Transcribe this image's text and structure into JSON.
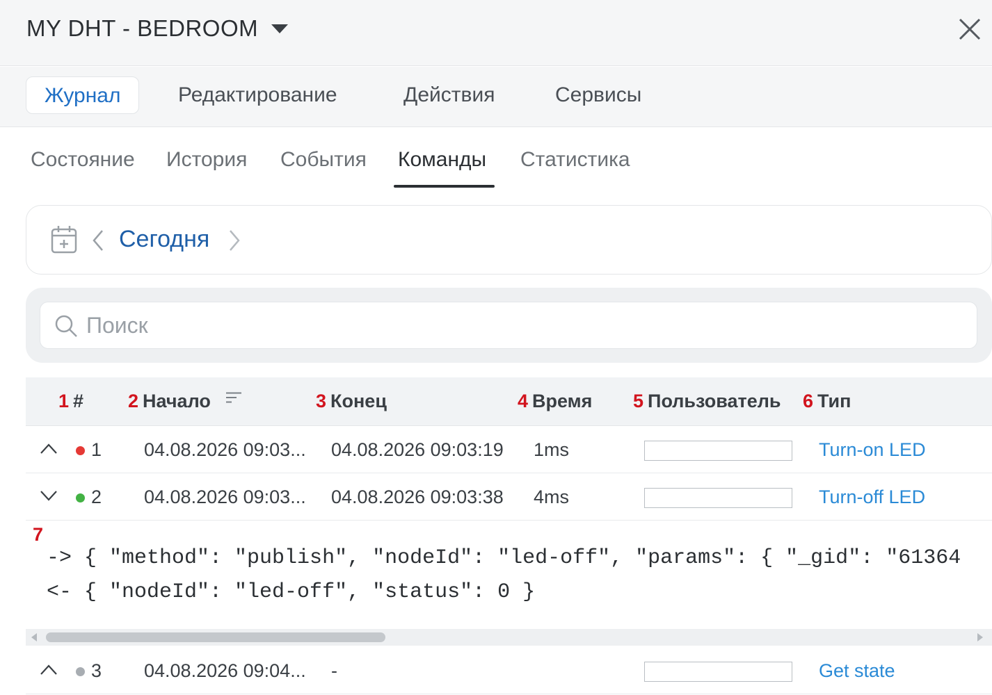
{
  "header": {
    "title": "MY DHT - BEDROOM",
    "dropdown_icon": "caret-down-icon",
    "close_icon": "close-icon"
  },
  "main_tabs": [
    {
      "label": "Журнал",
      "active": true
    },
    {
      "label": "Редактирование",
      "active": false
    },
    {
      "label": "Действия",
      "active": false
    },
    {
      "label": "Сервисы",
      "active": false
    }
  ],
  "sub_tabs": [
    {
      "label": "Состояние",
      "active": false
    },
    {
      "label": "История",
      "active": false
    },
    {
      "label": "События",
      "active": false
    },
    {
      "label": "Команды",
      "active": true
    },
    {
      "label": "Статистика",
      "active": false
    }
  ],
  "date_nav": {
    "label": "Сегодня",
    "calendar_icon": "calendar-icon",
    "prev_icon": "chevron-left-icon",
    "next_icon": "chevron-right-icon"
  },
  "search": {
    "placeholder": "Поиск",
    "value": "",
    "icon": "search-icon"
  },
  "table": {
    "columns": [
      {
        "num": "1",
        "label": "#"
      },
      {
        "num": "2",
        "label": "Начало",
        "sortable": true
      },
      {
        "num": "3",
        "label": "Конец"
      },
      {
        "num": "4",
        "label": "Время"
      },
      {
        "num": "5",
        "label": "Пользователь"
      },
      {
        "num": "6",
        "label": "Тип"
      }
    ],
    "rows": [
      {
        "id": "1",
        "expanded": false,
        "status_color": "#e53935",
        "start": "04.08.2026 09:03...",
        "end": "04.08.2026 09:03:19",
        "duration": "1ms",
        "user": "",
        "type": "Turn-on LED"
      },
      {
        "id": "2",
        "expanded": true,
        "status_color": "#43b244",
        "start": "04.08.2026 09:03...",
        "end": "04.08.2026 09:03:38",
        "duration": "4ms",
        "user": "",
        "type": "Turn-off LED"
      },
      {
        "id": "3",
        "expanded": false,
        "status_color": "#a8adb2",
        "start": "04.08.2026 09:04...",
        "end": "-",
        "duration": "",
        "user": "",
        "type": "Get state"
      }
    ],
    "details": {
      "num": "7",
      "request": "-> { \"method\": \"publish\", \"nodeId\": \"led-off\", \"params\": { \"_gid\": \"61364",
      "response": "<- { \"nodeId\": \"led-off\", \"status\": 0 }"
    }
  },
  "colors": {
    "accent": "#1f6fc5",
    "link": "#2a8ad6",
    "annotation": "#d2141e"
  }
}
